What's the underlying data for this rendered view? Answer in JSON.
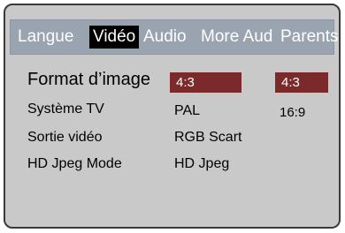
{
  "tabs": [
    {
      "label": "Langue",
      "active": false
    },
    {
      "label": "Vidéo",
      "active": true
    },
    {
      "label": "Audio",
      "active": false
    },
    {
      "label": "More Aud",
      "active": false
    },
    {
      "label": "Parents",
      "active": false
    }
  ],
  "settings": [
    {
      "label": "Format d’image",
      "value": "4:3"
    },
    {
      "label": "Système TV",
      "value": "PAL"
    },
    {
      "label": "Sortie vidéo",
      "value": "RGB Scart"
    },
    {
      "label": "HD Jpeg Mode",
      "value": "HD Jpeg"
    }
  ],
  "options": [
    "4:3",
    "16:9"
  ],
  "colors": {
    "tab_bar": "#9aa4b1",
    "panel_bg": "#c9c9c9",
    "highlight": "#7a2a2a",
    "active_tab": "#000000"
  }
}
